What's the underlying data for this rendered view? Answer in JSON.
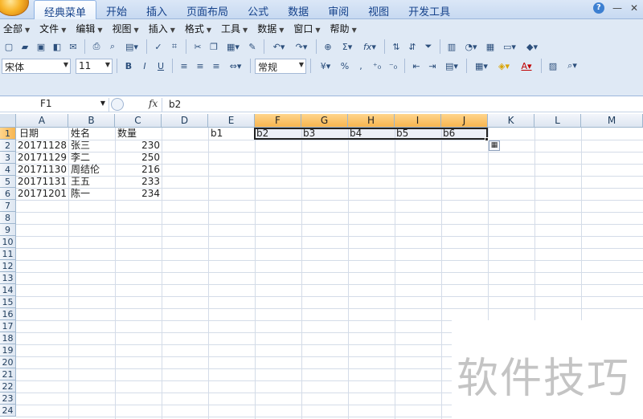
{
  "ribbon": {
    "tabs": [
      {
        "label": "经典菜单",
        "active": true
      },
      {
        "label": "开始",
        "active": false
      },
      {
        "label": "插入",
        "active": false
      },
      {
        "label": "页面布局",
        "active": false
      },
      {
        "label": "公式",
        "active": false
      },
      {
        "label": "数据",
        "active": false
      },
      {
        "label": "审阅",
        "active": false
      },
      {
        "label": "视图",
        "active": false
      },
      {
        "label": "开发工具",
        "active": false
      }
    ],
    "help_label": "?",
    "minimize": "—",
    "close": "✕"
  },
  "menu": {
    "items": [
      {
        "label": "全部"
      },
      {
        "label": "文件"
      },
      {
        "label": "编辑"
      },
      {
        "label": "视图"
      },
      {
        "label": "插入"
      },
      {
        "label": "格式"
      },
      {
        "label": "工具"
      },
      {
        "label": "数据"
      },
      {
        "label": "窗口"
      },
      {
        "label": "帮助"
      }
    ]
  },
  "toolbar": {
    "font_name": "宋体",
    "font_size": "11",
    "bold": "B",
    "italic": "I",
    "underline": "U",
    "number_format": "常规",
    "percent": "%",
    "comma": ",",
    "sigma": "Σ",
    "fx": "fx"
  },
  "formula_bar": {
    "name_box": "F1",
    "fx_label": "fx",
    "value": "b2"
  },
  "sheet": {
    "columns": [
      "A",
      "B",
      "C",
      "D",
      "E",
      "F",
      "G",
      "H",
      "I",
      "J",
      "K",
      "L",
      "M"
    ],
    "rows": [
      "1",
      "2",
      "3",
      "4",
      "5",
      "6",
      "7",
      "8",
      "9",
      "10",
      "11",
      "12",
      "13",
      "14",
      "15",
      "16",
      "17",
      "18",
      "19",
      "20",
      "21",
      "22",
      "23",
      "24"
    ],
    "header_row": {
      "A": "日期",
      "B": "姓名",
      "C": "数量",
      "E": "b1",
      "F": "b2",
      "G": "b3",
      "H": "b4",
      "I": "b5",
      "J": "b6"
    },
    "data_rows": [
      {
        "date": "20171128",
        "name": "张三",
        "qty": "230"
      },
      {
        "date": "20171129",
        "name": "李二",
        "qty": "250"
      },
      {
        "date": "20171130",
        "name": "周结伦",
        "qty": "216"
      },
      {
        "date": "20171131",
        "name": "王五",
        "qty": "233"
      },
      {
        "date": "20171201",
        "name": "陈一",
        "qty": "234"
      }
    ]
  },
  "watermark": "软件技巧"
}
